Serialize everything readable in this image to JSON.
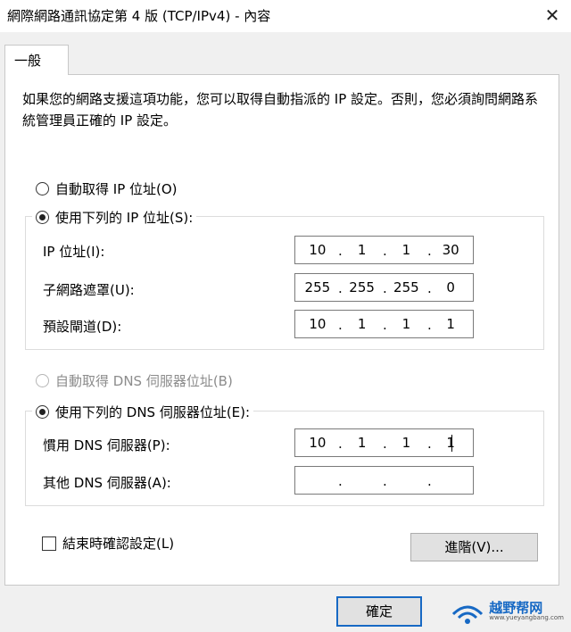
{
  "window": {
    "title": "網際網路通訊協定第 4 版 (TCP/IPv4) - 內容",
    "close_symbol": "✕"
  },
  "tab": {
    "label": "一般"
  },
  "description": "如果您的網路支援這項功能，您可以取得自動指派的 IP 設定。否則，您必須詢問網路系統管理員正確的 IP 設定。",
  "ip_section": {
    "auto_label": "自動取得 IP 位址(O)",
    "manual_label": "使用下列的 IP 位址(S):",
    "selected": "manual",
    "fields": [
      {
        "label": "IP 位址(I):",
        "octets": [
          "10",
          "1",
          "1",
          "30"
        ]
      },
      {
        "label": "子網路遮罩(U):",
        "octets": [
          "255",
          "255",
          "255",
          "0"
        ]
      },
      {
        "label": "預設閘道(D):",
        "octets": [
          "10",
          "1",
          "1",
          "1"
        ]
      }
    ]
  },
  "dns_section": {
    "auto_label": "自動取得 DNS 伺服器位址(B)",
    "auto_disabled": true,
    "manual_label": "使用下列的 DNS 伺服器位址(E):",
    "selected": "manual",
    "fields": [
      {
        "label": "慣用 DNS 伺服器(P):",
        "octets": [
          "10",
          "1",
          "1",
          "1"
        ]
      },
      {
        "label": "其他 DNS 伺服器(A):",
        "octets": [
          "",
          "",
          "",
          ""
        ]
      }
    ]
  },
  "validate_checkbox": {
    "label": "結束時確認設定(L)",
    "checked": false
  },
  "buttons": {
    "advanced": "進階(V)...",
    "ok": "確定"
  },
  "watermark": {
    "name": "越野帮网",
    "url": "www.yueyangbang.com"
  },
  "colors": {
    "accent": "#1769c4",
    "button_face": "#e1e1e1",
    "panel": "#ffffff",
    "window_bg": "#f0f0f0"
  }
}
